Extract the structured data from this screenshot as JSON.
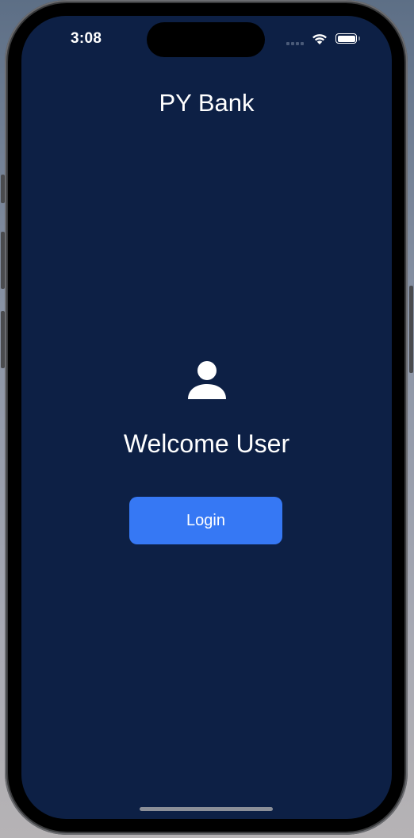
{
  "status_bar": {
    "time": "3:08",
    "signal_icon": "cellular-signal-icon",
    "wifi_icon": "wifi-icon",
    "battery_icon": "battery-icon",
    "battery_level": 1.0
  },
  "header": {
    "title": "PY Bank"
  },
  "main": {
    "user_icon": "person-icon",
    "welcome_text": "Welcome User",
    "login_label": "Login"
  },
  "colors": {
    "background": "#0d2045",
    "accent": "#3678f4",
    "text": "#ffffff"
  }
}
